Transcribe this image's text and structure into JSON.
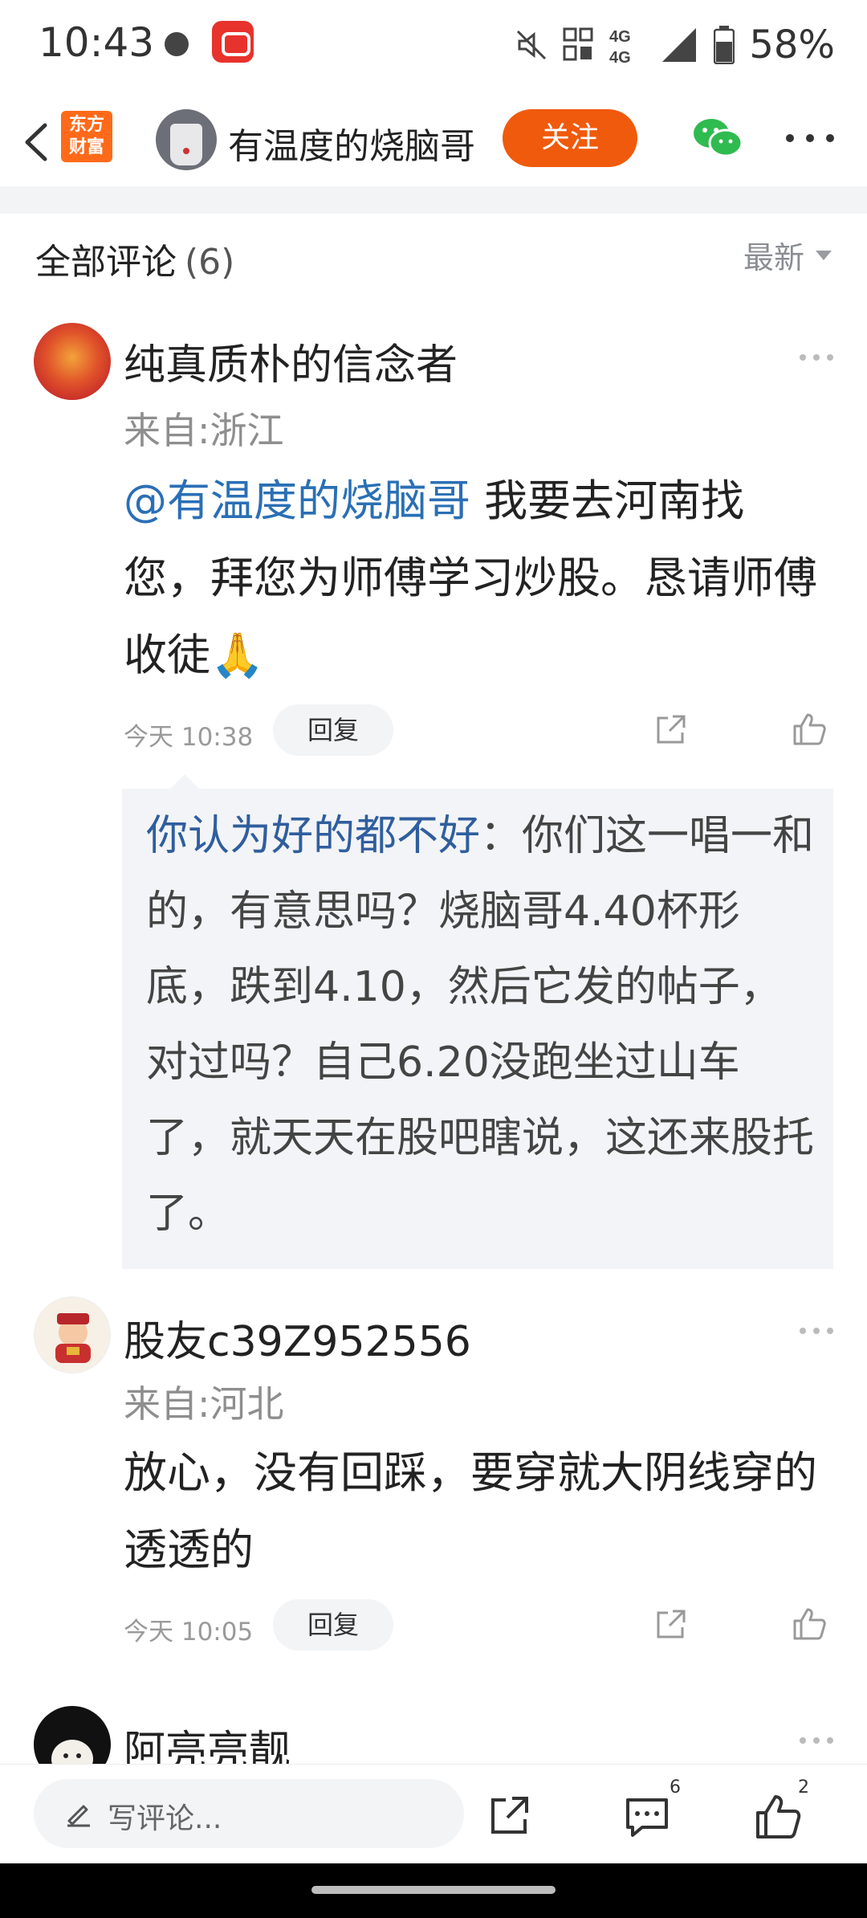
{
  "status_bar": {
    "time": "10:43",
    "network": "4G",
    "battery": "58%"
  },
  "header": {
    "logo_text": "东方财富",
    "author_name": "有温度的烧脑哥",
    "follow_label": "关注"
  },
  "section": {
    "title": "全部评论",
    "count": "(6)",
    "sort_label": "最新"
  },
  "comments": [
    {
      "name": "纯真质朴的信念者",
      "location": "来自:浙江",
      "mention": "@有温度的烧脑哥",
      "text": " 我要去河南找您，拜您为师傅学习炒股。恳请师傅收徒🙏",
      "time": "今天 10:38",
      "reply_label": "回复",
      "quote": {
        "name": "你认为好的都不好",
        "text": "：你们这一唱一和的，有意思吗？烧脑哥4.40杯形底，跌到4.10，然后它发的帖子，对过吗？自己6.20没跑坐过山车了，就天天在股吧瞎说，这还来股托了。"
      }
    },
    {
      "name": "股友c39Z952556",
      "location": "来自:河北",
      "text": "放心，没有回踩，要穿就大阴线穿的透透的",
      "time": "今天 10:05",
      "reply_label": "回复"
    },
    {
      "name": "阿亮亮靓"
    }
  ],
  "bottom_bar": {
    "placeholder": "写评论...",
    "comment_count": "6",
    "like_count": "2"
  },
  "colors": {
    "accent": "#f05a0c",
    "link": "#2a6fb5",
    "quote_name": "#2f5e9e"
  }
}
